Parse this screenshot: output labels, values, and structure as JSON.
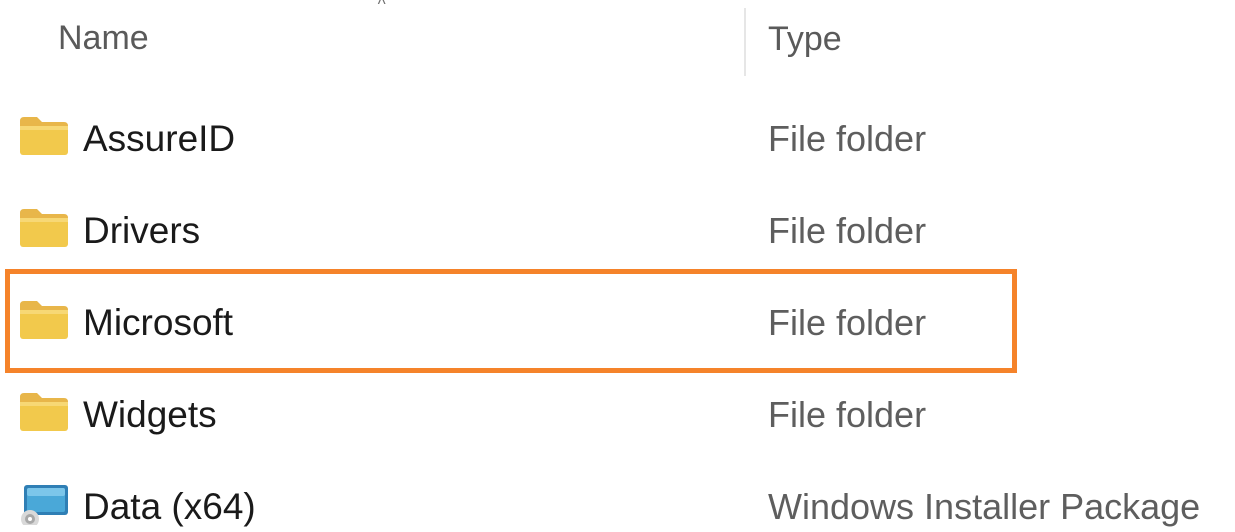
{
  "header": {
    "name_label": "Name",
    "type_label": "Type",
    "sort_indicator": "˄"
  },
  "rows": [
    {
      "name": "AssureID",
      "type": "File folder",
      "icon": "folder-icon"
    },
    {
      "name": "Drivers",
      "type": "File folder",
      "icon": "folder-icon"
    },
    {
      "name": "Microsoft",
      "type": "File folder",
      "icon": "folder-icon",
      "highlighted": true
    },
    {
      "name": "Widgets",
      "type": "File folder",
      "icon": "folder-icon"
    },
    {
      "name": "Data (x64)",
      "type": "Windows Installer Package",
      "icon": "installer-package-icon"
    }
  ],
  "colors": {
    "folder_body": "#f2c94c",
    "folder_tab": "#e8b64a",
    "highlight": "#f5832a"
  }
}
